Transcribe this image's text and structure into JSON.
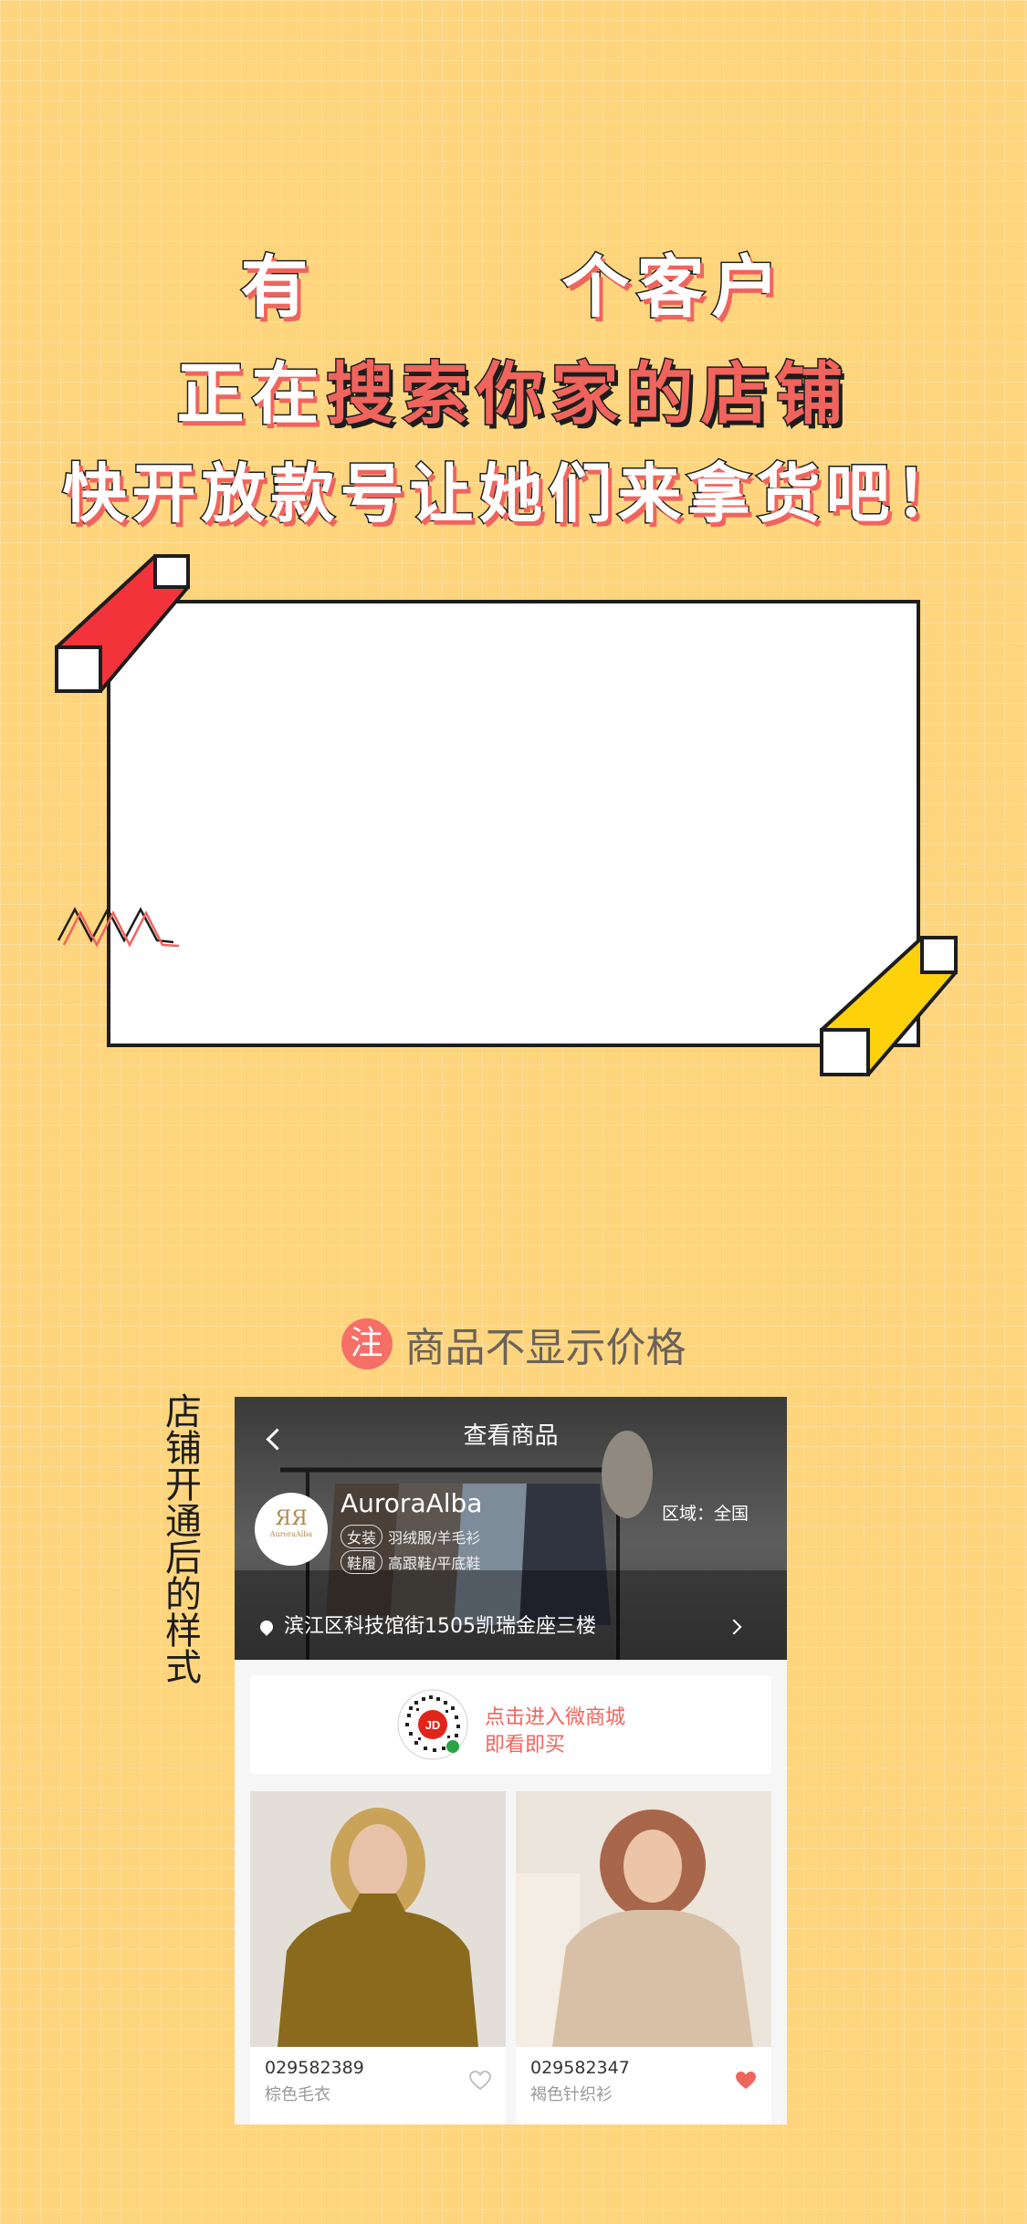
{
  "headline": {
    "line1": "有        个客户",
    "line2_prefix": "正在",
    "line2_accent": "搜索你家的店铺",
    "line3": "快开放款号让她们来拿货吧！"
  },
  "note": {
    "badge": "注",
    "text": "商品不显示价格"
  },
  "side_caption": "店铺开通后的样式",
  "phone": {
    "page_title": "查看商品",
    "shop": {
      "logo_text": "AuroraAlba",
      "name": "AuroraAlba",
      "region": "区域：全国",
      "tag_groups": [
        {
          "label": "女装",
          "items": "羽绒服/羊毛衫"
        },
        {
          "label": "鞋履",
          "items": "高跟鞋/平底鞋"
        }
      ],
      "address": "滨江区科技馆街1505凯瑞金座三楼"
    },
    "banner": {
      "line1": "点击进入微商城",
      "line2": "即看即买",
      "qr_badge": "JD"
    },
    "products": [
      {
        "code": "029582389",
        "name": "棕色毛衣",
        "liked": false,
        "color": "#8a6a1d"
      },
      {
        "code": "029582347",
        "name": "褐色针织衫",
        "liked": true,
        "color": "#d8c0a6"
      }
    ]
  },
  "colors": {
    "background": "#fed57d",
    "accent": "#f0645d",
    "outline": "#1d1d1d",
    "red_block": "#f3333a",
    "yellow_block": "#fdd20b"
  }
}
